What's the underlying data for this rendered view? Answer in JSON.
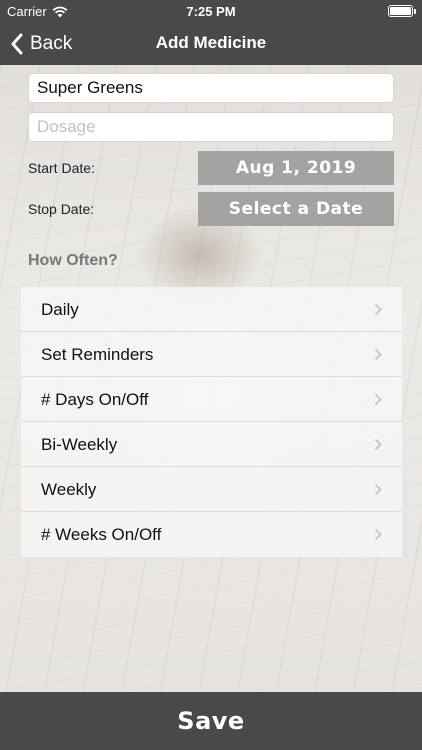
{
  "status_bar": {
    "carrier": "Carrier",
    "time": "7:25 PM"
  },
  "nav": {
    "back_label": "Back",
    "title": "Add Medicine"
  },
  "form": {
    "name_value": "Super Greens",
    "dosage_value": "",
    "dosage_placeholder": "Dosage",
    "start_date_label": "Start Date:",
    "start_date_value": "Aug 1, 2019",
    "stop_date_label": "Stop Date:",
    "stop_date_value": "Select a Date"
  },
  "frequency": {
    "heading": "How Often?",
    "options": [
      {
        "label": "Daily"
      },
      {
        "label": "Set Reminders"
      },
      {
        "label": "# Days On/Off"
      },
      {
        "label": "Bi-Weekly"
      },
      {
        "label": "Weekly"
      },
      {
        "label": "# Weeks On/Off"
      }
    ]
  },
  "footer": {
    "save_label": "Save"
  },
  "colors": {
    "nav_background": "#4a4948",
    "date_button": "#a3a3a3"
  }
}
